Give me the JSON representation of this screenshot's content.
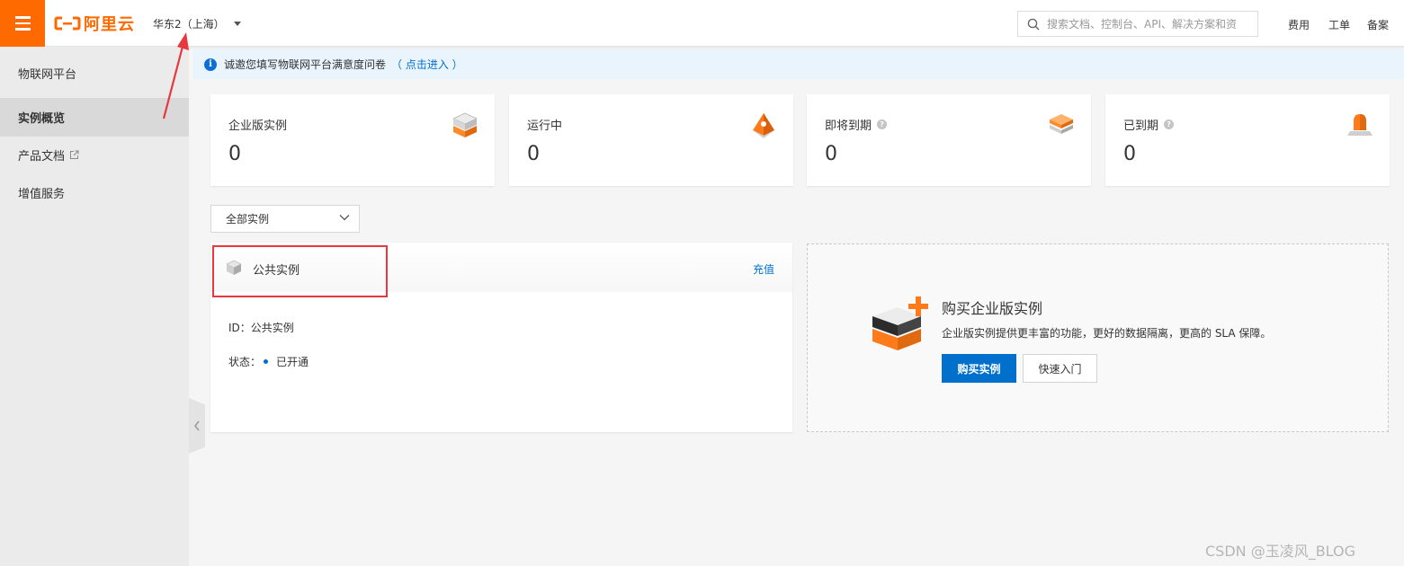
{
  "header": {
    "logo_text": "阿里云",
    "region": "华东2（上海）",
    "search_placeholder": "搜索文档、控制台、API、解决方案和资",
    "links": [
      "费用",
      "工单",
      "备案"
    ],
    "brand_color": "#ff6a00"
  },
  "sidebar": {
    "title": "物联网平台",
    "items": [
      {
        "label": "实例概览",
        "active": true
      },
      {
        "label": "产品文档",
        "external": true
      },
      {
        "label": "增值服务"
      }
    ]
  },
  "notice": {
    "text": "诚邀您填写物联网平台满意度问卷",
    "link": "（ 点击进入 ）"
  },
  "stats": [
    {
      "label": "企业版实例",
      "value": "0",
      "icon": "stacked-server-icon"
    },
    {
      "label": "运行中",
      "value": "0",
      "icon": "running-pyramid-icon"
    },
    {
      "label": "即将到期",
      "value": "0",
      "icon": "layered-box-icon",
      "help": "?"
    },
    {
      "label": "已到期",
      "value": "0",
      "icon": "alarm-light-icon",
      "help": "?"
    }
  ],
  "filter": {
    "selected": "全部实例"
  },
  "instance": {
    "title": "公共实例",
    "action": "充值",
    "id_label": "ID：",
    "id_value": "公共实例",
    "status_label": "状态：",
    "status_value": "已开通"
  },
  "buy": {
    "title": "购买企业版实例",
    "desc": "企业版实例提供更丰富的功能，更好的数据隔离，更高的 SLA 保障。",
    "primary_button": "购买实例",
    "secondary_button": "快速入门"
  },
  "watermark": "CSDN @玉凌风_BLOG",
  "colors": {
    "accent": "#0070cc",
    "highlight": "#e8383d",
    "orange": "#ff6a00"
  }
}
